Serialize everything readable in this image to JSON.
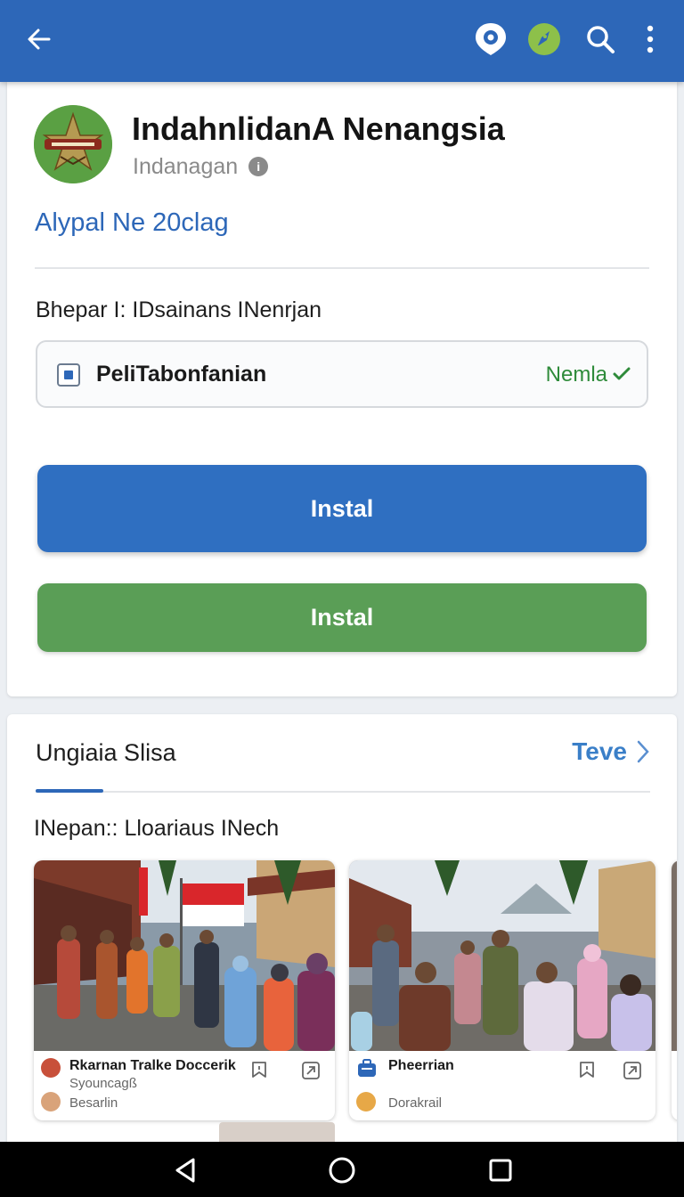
{
  "appbar": {
    "back_icon": "arrow-back-icon",
    "actions": [
      {
        "name": "settings-badge-icon",
        "color": "#ffffff"
      },
      {
        "name": "rocket-badge-icon",
        "color": "#8dc04a"
      },
      {
        "name": "search-icon",
        "color": "#ffffff"
      },
      {
        "name": "more-vert-icon",
        "color": "#ffffff"
      }
    ],
    "color": "#2d67b8"
  },
  "app": {
    "title": "IndahnlidanA Nenangsia",
    "developer": "Indanagan",
    "info_icon_glyph": "i",
    "version": "Alypal Ne 20clag"
  },
  "section": {
    "label": "Bhepar I: IDsainans INenrjan"
  },
  "selector": {
    "label": "PeliTabonfanian",
    "value": "Nemla",
    "value_color": "#2e8b3a"
  },
  "buttons": {
    "primary": "Instal",
    "primary_color": "#2f6fc1",
    "secondary": "Instal",
    "secondary_color": "#5a9e56"
  },
  "media_section": {
    "title": "Ungiaia Slisa",
    "see_all": "Teve",
    "subtitle": "INepan:: Lloariaus INech"
  },
  "media_cards": [
    {
      "title": "Rkarnan Tralke Doccerik",
      "subtitle": "Syouncagß",
      "author": "Besarlin"
    },
    {
      "title": "Pheerrian",
      "author": "Dorakrail"
    }
  ],
  "navbar": {
    "back": "nav-back-icon",
    "home": "nav-home-icon",
    "recents": "nav-recents-icon"
  }
}
